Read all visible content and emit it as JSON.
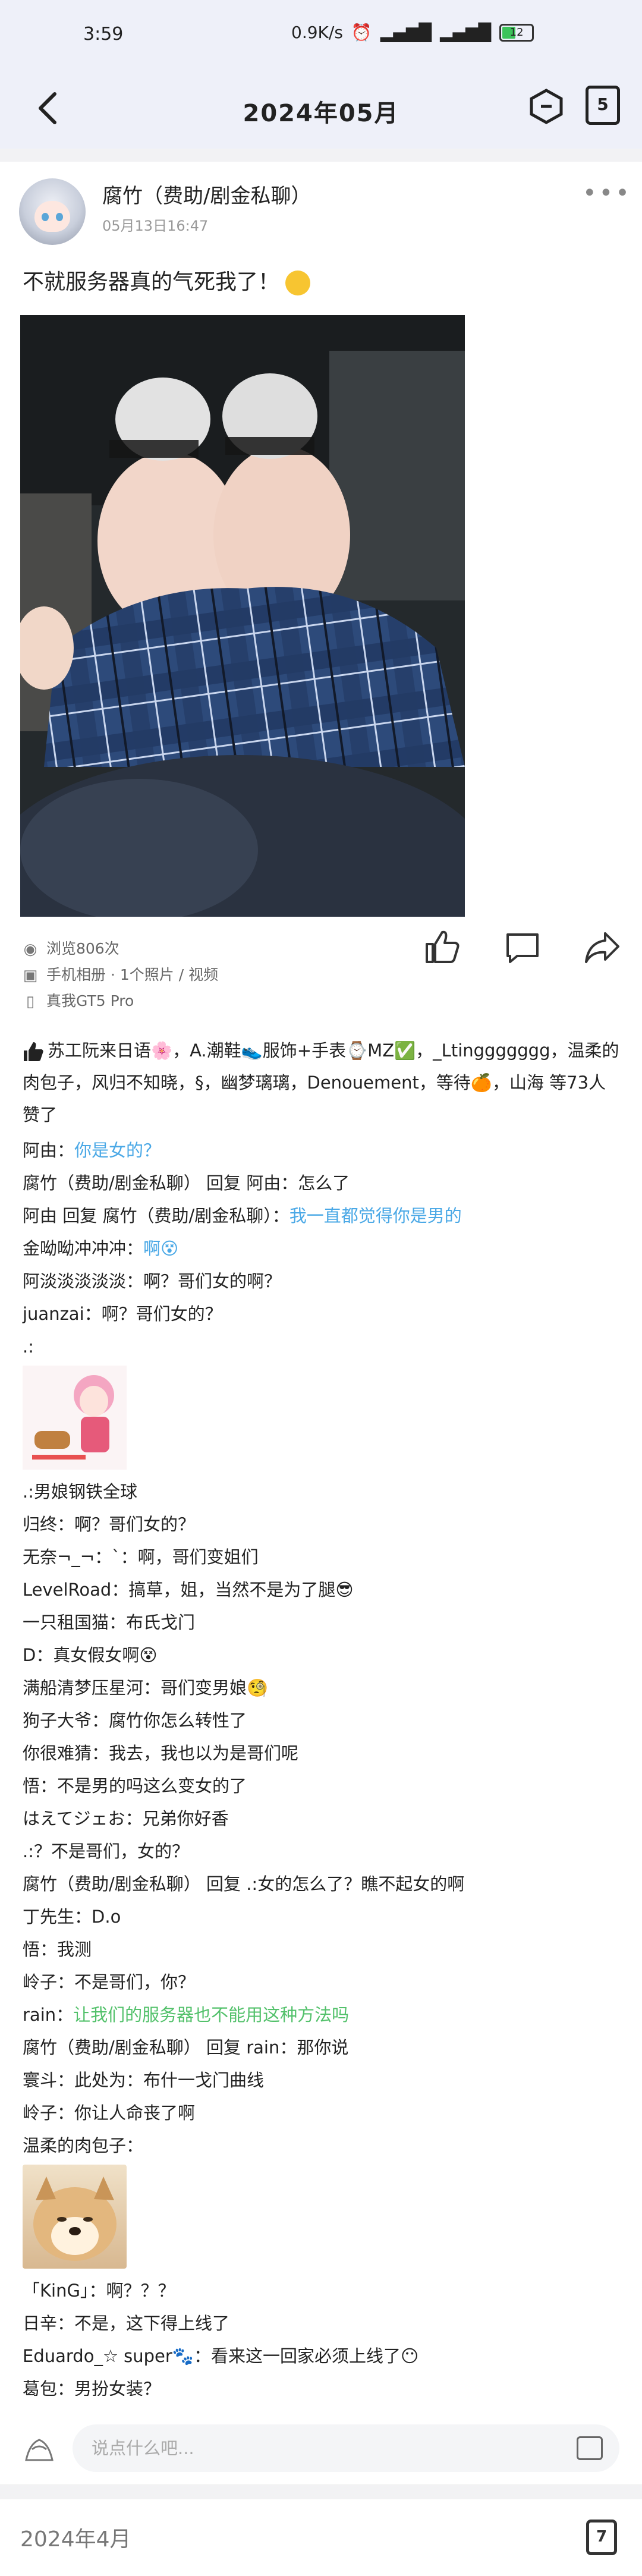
{
  "status_bar": {
    "time": "3:59",
    "net_speed": "0.9K/s",
    "battery": "12"
  },
  "nav": {
    "title": "2024年05月",
    "calendar_day": "5"
  },
  "post": {
    "author": "腐竹（费助/剧金私聊）",
    "time": "05月13日16:47",
    "text": "不就服务器真的气死我了！",
    "views": "浏览806次",
    "album": "手机相册 · 1个照片 / 视频",
    "device": "真我GT5 Pro"
  },
  "likes": {
    "text": "苏工阮来日语🌸，A.潮鞋👟服饰+手表⌚MZ✅，_Ltinggggggg，温柔的肉包子，风归不知晓，§，幽梦璃璃，Denouement，等待🍊，山海 等73人赞了"
  },
  "comments": [
    {
      "name": "阿由",
      "sep": "：",
      "text": "你是女的？",
      "style": "blue"
    },
    {
      "name": "腐竹（费助/剧金私聊）",
      "sep": " 回复 阿由：",
      "text": "怎么了",
      "style": "normal"
    },
    {
      "name": "阿由",
      "sep": " 回复 腐竹（费助/剧金私聊）：",
      "text": "我一直都觉得你是男的",
      "style": "blue"
    },
    {
      "name": "金呦呦冲冲冲",
      "sep": "：",
      "text": "啊😵",
      "style": "blue"
    },
    {
      "name": "阿淡淡淡淡淡",
      "sep": "：",
      "text": "啊？哥们女的啊？",
      "style": "normal"
    },
    {
      "name": "juanzai",
      "sep": "：",
      "text": "啊？哥们女的？",
      "style": "normal"
    },
    {
      "name": ".:",
      "sep": "",
      "text": "",
      "style": "normal",
      "sticker": "sticker1"
    },
    {
      "name": ".:",
      "sep": "",
      "text": "男娘钢铁全球",
      "style": "normal"
    },
    {
      "name": "归终",
      "sep": "：",
      "text": "啊？哥们女的？",
      "style": "normal"
    },
    {
      "name": "无奈¬_¬",
      "sep": "：",
      "text": "`：啊，哥们变姐们",
      "style": "normal"
    },
    {
      "name": "LevelRoad",
      "sep": "：",
      "text": "搞草，姐，当然不是为了腿😎",
      "style": "normal"
    },
    {
      "name": "一只租国猫",
      "sep": "：",
      "text": "布氏戈门",
      "style": "normal"
    },
    {
      "name": "D",
      "sep": "：",
      "text": "真女假女啊😵",
      "style": "normal"
    },
    {
      "name": "满船清梦压星河",
      "sep": "：",
      "text": "哥们变男娘🧐",
      "style": "normal"
    },
    {
      "name": "狗子大爷",
      "sep": "：",
      "text": "腐竹你怎么转性了",
      "style": "normal"
    },
    {
      "name": "你很难猜",
      "sep": "：",
      "text": "我去，我也以为是哥们呢",
      "style": "normal"
    },
    {
      "name": "悟",
      "sep": "：",
      "text": "不是男的吗这么变女的了",
      "style": "normal"
    },
    {
      "name": "はえてジェお",
      "sep": "：",
      "text": "兄弟你好香",
      "style": "normal"
    },
    {
      "name": ".:",
      "sep": "",
      "text": "？不是哥们，女的？",
      "style": "normal"
    },
    {
      "name": "腐竹（费助/剧金私聊）",
      "sep": " 回复 .:",
      "text": "女的怎么了？瞧不起女的啊",
      "style": "normal"
    },
    {
      "name": "丁先生",
      "sep": "：",
      "text": "D.o",
      "style": "normal"
    },
    {
      "name": "悟",
      "sep": "：",
      "text": "我测",
      "style": "normal"
    },
    {
      "name": "岭子",
      "sep": "：",
      "text": "不是哥们，你？",
      "style": "normal"
    },
    {
      "name": "rain",
      "sep": "：",
      "text": "让我们的服务器也不能用这种方法吗",
      "style": "green"
    },
    {
      "name": "腐竹（费助/剧金私聊）",
      "sep": " 回复 rain：",
      "text": "那你说",
      "style": "normal"
    },
    {
      "name": "寰斗",
      "sep": "：",
      "text": "此处为：布什一戈门曲线",
      "style": "normal"
    },
    {
      "name": "岭子",
      "sep": "：",
      "text": "你让人命丧了啊",
      "style": "normal"
    },
    {
      "name": "温柔的肉包子",
      "sep": "：",
      "text": "",
      "style": "normal",
      "sticker": "sticker2"
    },
    {
      "name": "「KinG」",
      "sep": "：",
      "text": "啊？？？",
      "style": "normal"
    },
    {
      "name": "日辛",
      "sep": "：",
      "text": "不是，这下得上线了",
      "style": "normal"
    },
    {
      "name": "Eduardo_☆ super🐾",
      "sep": "：",
      "text": "看来这一回家必须上线了😶",
      "style": "normal"
    },
    {
      "name": "葛包",
      "sep": "：",
      "text": "男扮女装？",
      "style": "normal"
    }
  ],
  "input": {
    "placeholder": "说点什么吧..."
  },
  "next_section": {
    "title": "2024年4月",
    "calendar_day": "7"
  },
  "colors": {
    "accent_blue": "#4aa8e6",
    "accent_green": "#53c16b",
    "header_bg": "#eef0f9"
  }
}
